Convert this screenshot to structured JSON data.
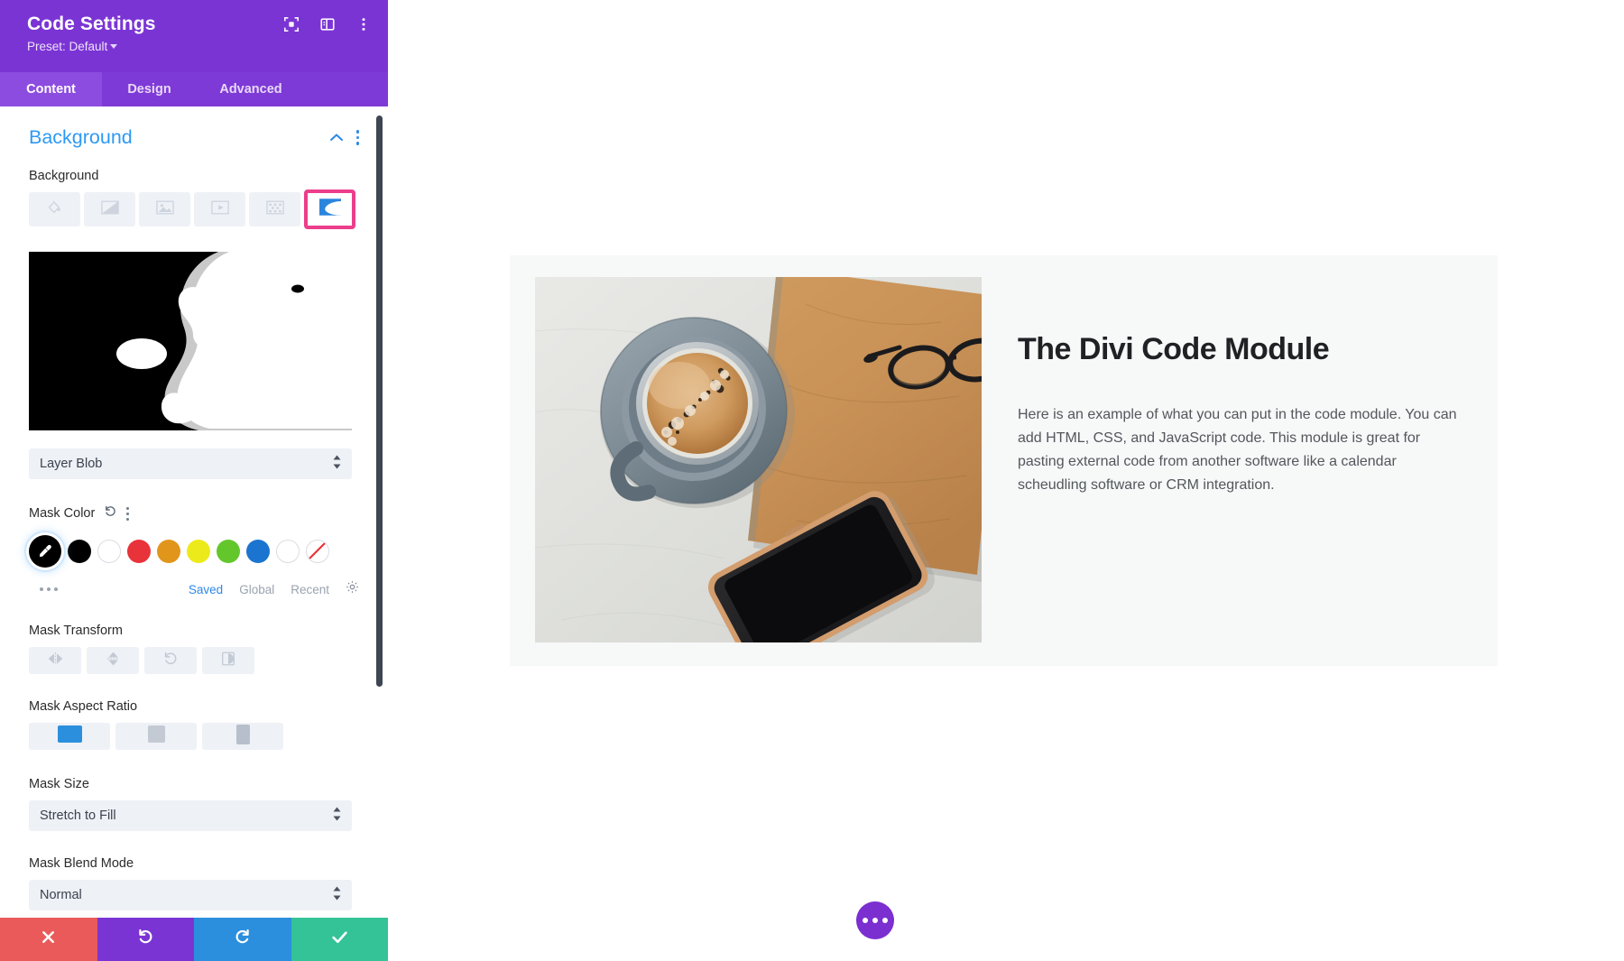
{
  "panel": {
    "title": "Code Settings",
    "preset": "Preset: Default",
    "header_icons": [
      "focus-target-icon",
      "panel-layout-icon",
      "vertical-dots-icon"
    ],
    "tabs": [
      {
        "label": "Content",
        "active": true
      },
      {
        "label": "Design",
        "active": false
      },
      {
        "label": "Advanced",
        "active": false
      }
    ],
    "section": {
      "title": "Background",
      "collapse_icon": "chevron-up-icon",
      "menu_icon": "vertical-dots-icon"
    },
    "background_field": {
      "label": "Background",
      "types": [
        {
          "name": "background-color",
          "icon": "paint-bucket-icon",
          "selected": false
        },
        {
          "name": "background-gradient",
          "icon": "gradient-icon",
          "selected": false
        },
        {
          "name": "background-image",
          "icon": "image-icon",
          "selected": false
        },
        {
          "name": "background-video",
          "icon": "video-icon",
          "selected": false
        },
        {
          "name": "background-pattern",
          "icon": "pattern-icon",
          "selected": false
        },
        {
          "name": "background-mask",
          "icon": "mask-icon",
          "selected": true
        }
      ],
      "selected_outline_color": "#ec3e8b"
    },
    "mask_preview": {
      "name": "mask-preview",
      "shape": "layer-blob",
      "fg": "#ffffff",
      "bg": "#000000"
    },
    "mask_style_select": {
      "value": "Layer Blob"
    },
    "mask_color": {
      "label": "Mask Color",
      "reset_icon": "reset-arrow-icon",
      "menu_icon": "vertical-dots-icon",
      "swatches": [
        {
          "name": "color-picker",
          "color": "#000000",
          "selected": true
        },
        {
          "name": "swatch-black",
          "color": "#000000"
        },
        {
          "name": "swatch-white",
          "color": "#ffffff"
        },
        {
          "name": "swatch-red",
          "color": "#e8333a"
        },
        {
          "name": "swatch-orange",
          "color": "#e2951b"
        },
        {
          "name": "swatch-yellow",
          "color": "#edea1b"
        },
        {
          "name": "swatch-green",
          "color": "#63c72c"
        },
        {
          "name": "swatch-blue",
          "color": "#1b75d0"
        },
        {
          "name": "swatch-white-2",
          "color": "#ffffff"
        },
        {
          "name": "swatch-transparent",
          "color": "transparent"
        }
      ],
      "more_dots": "horizontal-dots-icon",
      "links": [
        {
          "label": "Saved",
          "active": true
        },
        {
          "label": "Global",
          "active": false
        },
        {
          "label": "Recent",
          "active": false
        }
      ],
      "settings_icon": "gear-icon"
    },
    "mask_transform": {
      "label": "Mask Transform",
      "buttons": [
        {
          "name": "flip-horizontal-button",
          "icon": "flip-horizontal-icon"
        },
        {
          "name": "flip-vertical-button",
          "icon": "flip-vertical-icon"
        },
        {
          "name": "rotate-button",
          "icon": "rotate-ccw-icon"
        },
        {
          "name": "invert-button",
          "icon": "invert-icon"
        }
      ]
    },
    "mask_aspect_ratio": {
      "label": "Mask Aspect Ratio",
      "options": [
        {
          "name": "aspect-landscape",
          "icon": "landscape-icon",
          "selected": true
        },
        {
          "name": "aspect-square",
          "icon": "square-icon",
          "selected": false
        },
        {
          "name": "aspect-portrait",
          "icon": "portrait-icon",
          "selected": false
        }
      ],
      "selected_color": "#2b8fdd"
    },
    "mask_size": {
      "label": "Mask Size",
      "value": "Stretch to Fill"
    },
    "mask_blend_mode": {
      "label": "Mask Blend Mode",
      "value": "Normal"
    },
    "bottom_bar": [
      {
        "name": "cancel-button",
        "icon": "close-x-icon",
        "color": "#ea5a5a"
      },
      {
        "name": "undo-button",
        "icon": "undo-icon",
        "color": "#7b34d4"
      },
      {
        "name": "redo-button",
        "icon": "redo-icon",
        "color": "#2b8fdd"
      },
      {
        "name": "save-button",
        "icon": "check-icon",
        "color": "#34c297"
      }
    ],
    "colors": {
      "header": "#7b34d4",
      "tabbar": "#7e3ad6",
      "accent_blue": "#2d99f3"
    }
  },
  "canvas": {
    "module": {
      "photo_alt": "Flat lay photo of a coffee cup on a saucer, a tan notebook with eyeglasses, and a smartphone on a white table",
      "heading": "The Divi Code Module",
      "paragraph": "Here is an example of what you can put in the code module. You can add HTML, CSS, and JavaScript code. This module is great for pasting external code from another software like a calendar scheudling software or CRM integration."
    },
    "fab": {
      "name": "page-settings-fab",
      "icon": "horizontal-dots-icon",
      "color": "#7b2fd0"
    }
  }
}
